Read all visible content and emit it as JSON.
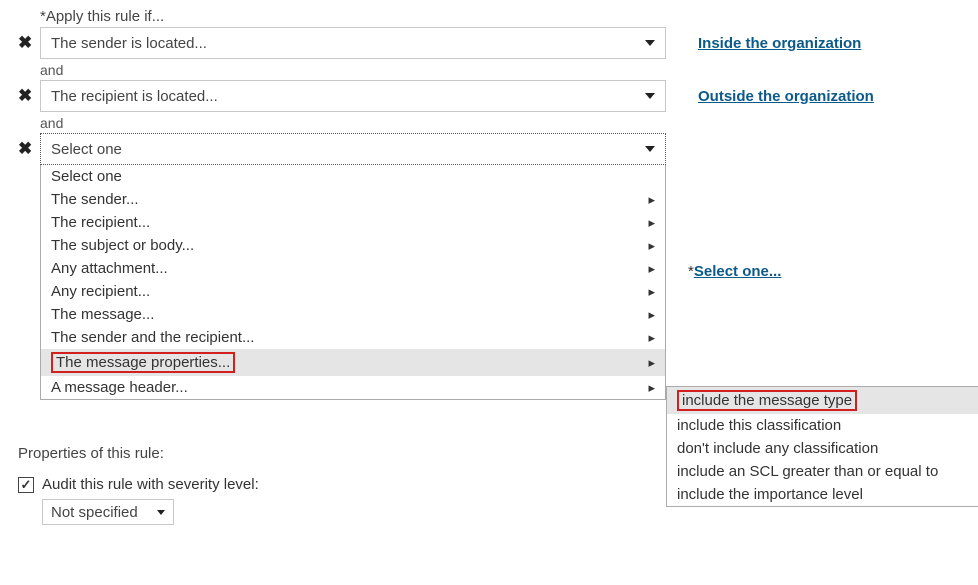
{
  "title": "*Apply this rule if...",
  "conditions": [
    {
      "value": "The sender is located...",
      "link": "Inside the organization"
    },
    {
      "value": "The recipient is located...",
      "link": "Outside the organization"
    }
  ],
  "and": "and",
  "select_placeholder": "Select one",
  "select_link_prefix": "*",
  "select_link": "Select one...",
  "menu": {
    "first": "Select one",
    "items": [
      "The sender...",
      "The recipient...",
      "The subject or body...",
      "Any attachment...",
      "Any recipient...",
      "The message...",
      "The sender and the recipient...",
      "The message properties...",
      "A message header..."
    ],
    "highlight_index": 7
  },
  "submenu": {
    "items": [
      "include the message type",
      "include this classification",
      "don't include any classification",
      "include an SCL greater than or equal to",
      "include the importance level"
    ],
    "highlight_index": 0
  },
  "properties_title": "Properties of this rule:",
  "audit_label": "Audit this rule with severity level:",
  "audit_checked": true,
  "severity_value": "Not specified"
}
